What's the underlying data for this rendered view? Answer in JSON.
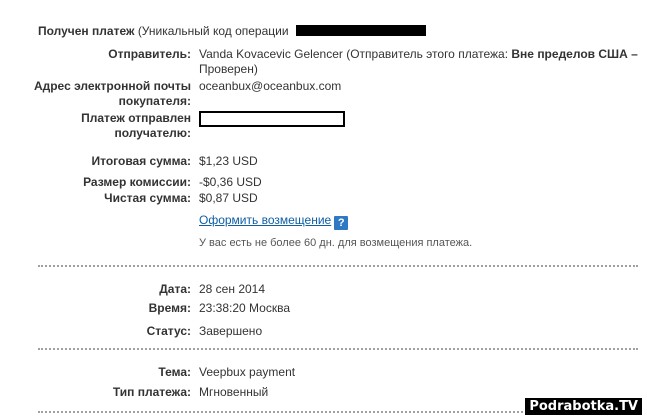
{
  "header": {
    "title": "Получен платеж",
    "suffix": "(Уникальный код операции"
  },
  "sender": {
    "label": "Отправитель:",
    "name": "Vanda Kovacevic Gelencer",
    "line1_rest": "(Отправитель этого платежа:",
    "status_bold": "Вне пределов США –",
    "line2": "Проверен)"
  },
  "buyer_email": {
    "label_line1": "Адрес электронной почты",
    "label_line2": "покупателя:",
    "value": "oceanbux@oceanbux.com"
  },
  "sent_to": {
    "label_line1": "Платеж отправлен",
    "label_line2": "получателю:"
  },
  "amounts": {
    "total_label": "Итоговая сумма:",
    "total_value": "$1,23 USD",
    "fee_label": "Размер комиссии:",
    "fee_value": "-$0,36 USD",
    "net_label": "Чистая сумма:",
    "net_value": "$0,87 USD"
  },
  "refund": {
    "link_label": "Оформить возмещение",
    "help_icon": "?",
    "note": "У вас есть не более 60 дн. для возмещения платежа."
  },
  "details": {
    "date_label": "Дата:",
    "date_value": "28 сен 2014",
    "time_label": "Время:",
    "time_value": "23:38:20 Москва",
    "status_label": "Статус:",
    "status_value": "Завершено"
  },
  "payment": {
    "subject_label": "Тема:",
    "subject_value": "Veepbux payment",
    "type_label": "Тип платежа:",
    "type_value": "Мгновенный"
  },
  "watermark": "Podrabotka.TV"
}
